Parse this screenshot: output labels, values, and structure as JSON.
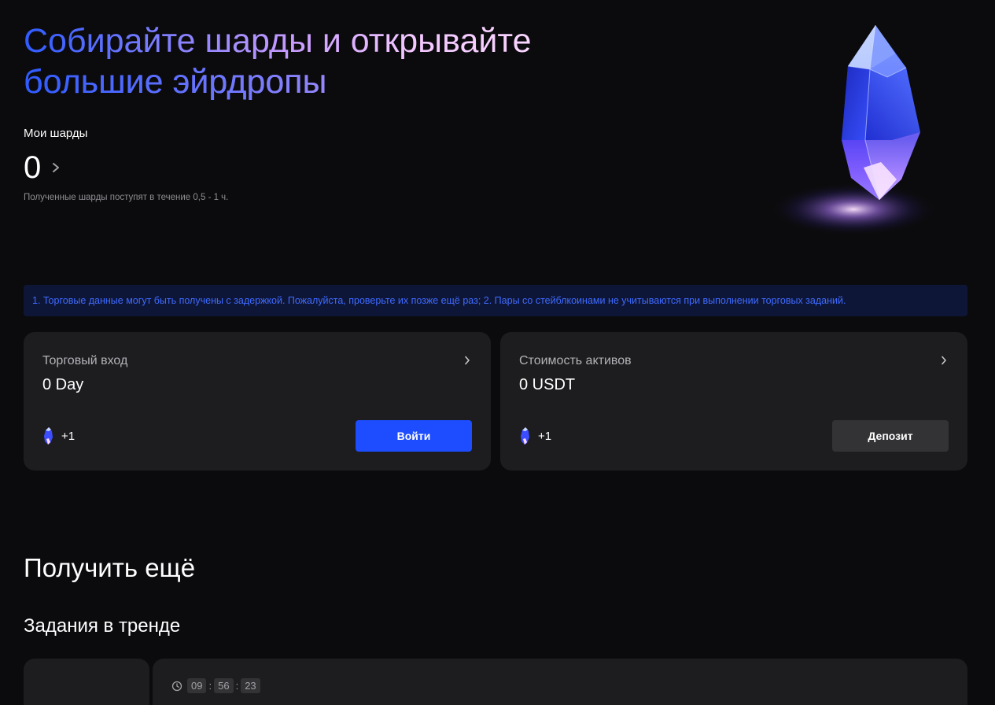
{
  "hero": {
    "title_line1": "Собирайте шарды и открывайте",
    "title_line2": "большие эйрдропы"
  },
  "shards": {
    "label": "Мои шарды",
    "value": "0",
    "note": "Полученные шарды поступят в течение 0,5 - 1 ч."
  },
  "notice": "1. Торговые данные могут быть получены с задержкой. Пожалуйста, проверьте их позже ещё раз; 2. Пары со стейблкоинами не учитываются при выполнении торговых заданий.",
  "cards": [
    {
      "title": "Торговый вход",
      "value": "0 Day",
      "reward": "+1",
      "button": "Войти"
    },
    {
      "title": "Стоимость активов",
      "value": "0 USDT",
      "reward": "+1",
      "button": "Депозит"
    }
  ],
  "more": {
    "title": "Получить ещё",
    "trending_title": "Задания в тренде"
  },
  "task": {
    "timer": {
      "hours": "09",
      "minutes": "56",
      "seconds": "23",
      "separator": ":"
    }
  },
  "colors": {
    "background": "#0b0b0d",
    "card": "#1d1d1f",
    "primary_button": "#1e4dff",
    "secondary_button": "#333336",
    "notice_bg": "#0e1638",
    "notice_text": "#3f6bff"
  },
  "icons": [
    "chevron-right-icon",
    "crystal-icon",
    "clock-icon"
  ]
}
